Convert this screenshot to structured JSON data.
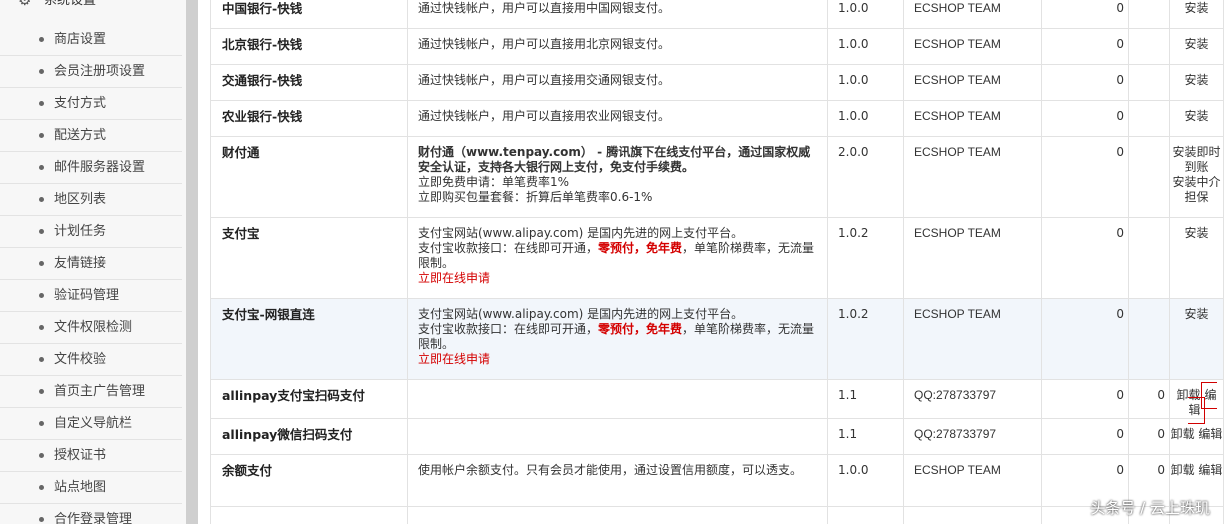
{
  "sidebar": {
    "section_label": "系统设置",
    "collapse_symbol": "−",
    "items": [
      {
        "label": "商店设置"
      },
      {
        "label": "会员注册项设置"
      },
      {
        "label": "支付方式"
      },
      {
        "label": "配送方式"
      },
      {
        "label": "邮件服务器设置"
      },
      {
        "label": "地区列表"
      },
      {
        "label": "计划任务"
      },
      {
        "label": "友情链接"
      },
      {
        "label": "验证码管理"
      },
      {
        "label": "文件权限检测"
      },
      {
        "label": "文件校验"
      },
      {
        "label": "首页主广告管理"
      },
      {
        "label": "自定义导航栏"
      },
      {
        "label": "授权证书"
      },
      {
        "label": "站点地图"
      },
      {
        "label": "合作登录管理"
      }
    ]
  },
  "rows": [
    {
      "name": "中国银行-快钱",
      "desc": "通过快钱帐户，用户可以直接用中国网银支付。",
      "version": "1.0.0",
      "author": "ECSHOP TEAM",
      "fee": "0",
      "order": "",
      "action": "安装"
    },
    {
      "name": "北京银行-快钱",
      "desc": "通过快钱帐户，用户可以直接用北京网银支付。",
      "version": "1.0.0",
      "author": "ECSHOP TEAM",
      "fee": "0",
      "order": "",
      "action": "安装"
    },
    {
      "name": "交通银行-快钱",
      "desc": "通过快钱帐户，用户可以直接用交通网银支付。",
      "version": "1.0.0",
      "author": "ECSHOP TEAM",
      "fee": "0",
      "order": "",
      "action": "安装"
    },
    {
      "name": "农业银行-快钱",
      "desc": "通过快钱帐户，用户可以直接用农业网银支付。",
      "version": "1.0.0",
      "author": "ECSHOP TEAM",
      "fee": "0",
      "order": "",
      "action": "安装"
    },
    {
      "name": "财付通",
      "desc_bold": "财付通（www.tenpay.com） - 腾讯旗下在线支付平台，通过国家权威安全认证，支持各大银行网上支付，免支付手续费。",
      "desc_line2": "立即免费申请：单笔费率1%",
      "desc_line3": "立即购买包量套餐：折算后单笔费率0.6-1%",
      "version": "2.0.0",
      "author": "ECSHOP TEAM",
      "fee": "0",
      "order": "",
      "action": "安装即时到账",
      "action2": "安装中介担保"
    },
    {
      "name": "支付宝",
      "desc_line1": "支付宝网站(www.alipay.com) 是国内先进的网上支付平台。",
      "desc_pre": "支付宝收款接口：在线即可开通，",
      "desc_red": "零预付，免年费",
      "desc_post": "，单笔阶梯费率，无流量限制。",
      "desc_link": "立即在线申请",
      "version": "1.0.2",
      "author": "ECSHOP TEAM",
      "fee": "0",
      "order": "",
      "action": "安装"
    },
    {
      "name": "支付宝-网银直连",
      "desc_line1": "支付宝网站(www.alipay.com) 是国内先进的网上支付平台。",
      "desc_pre": "支付宝收款接口：在线即可开通，",
      "desc_red": "零预付，免年费",
      "desc_post": "，单笔阶梯费率，无流量限制。",
      "desc_link": "立即在线申请",
      "version": "1.0.2",
      "author": "ECSHOP TEAM",
      "fee": "0",
      "order": "",
      "action": "安装"
    },
    {
      "name": "allinpay支付宝扫码支付",
      "desc": "",
      "version": "1.1",
      "author": "QQ:278733797",
      "fee": "0",
      "order": "0",
      "action": "卸载",
      "action2": "编辑"
    },
    {
      "name": "allinpay微信扫码支付",
      "desc": "",
      "version": "1.1",
      "author": "QQ:278733797",
      "fee": "0",
      "order": "0",
      "action": "卸载",
      "action2": "编辑"
    },
    {
      "name": "余额支付",
      "desc": "使用帐户余额支付。只有会员才能使用，通过设置信用额度，可以透支。",
      "version": "1.0.0",
      "author": "ECSHOP TEAM",
      "fee": "0",
      "order": "0",
      "action": "卸载",
      "action2": "编辑"
    }
  ],
  "watermark": "头条号 / 云上珠玑",
  "colors": {
    "accent_red": "#d40000",
    "highlight_row": "#f2f6fb"
  }
}
